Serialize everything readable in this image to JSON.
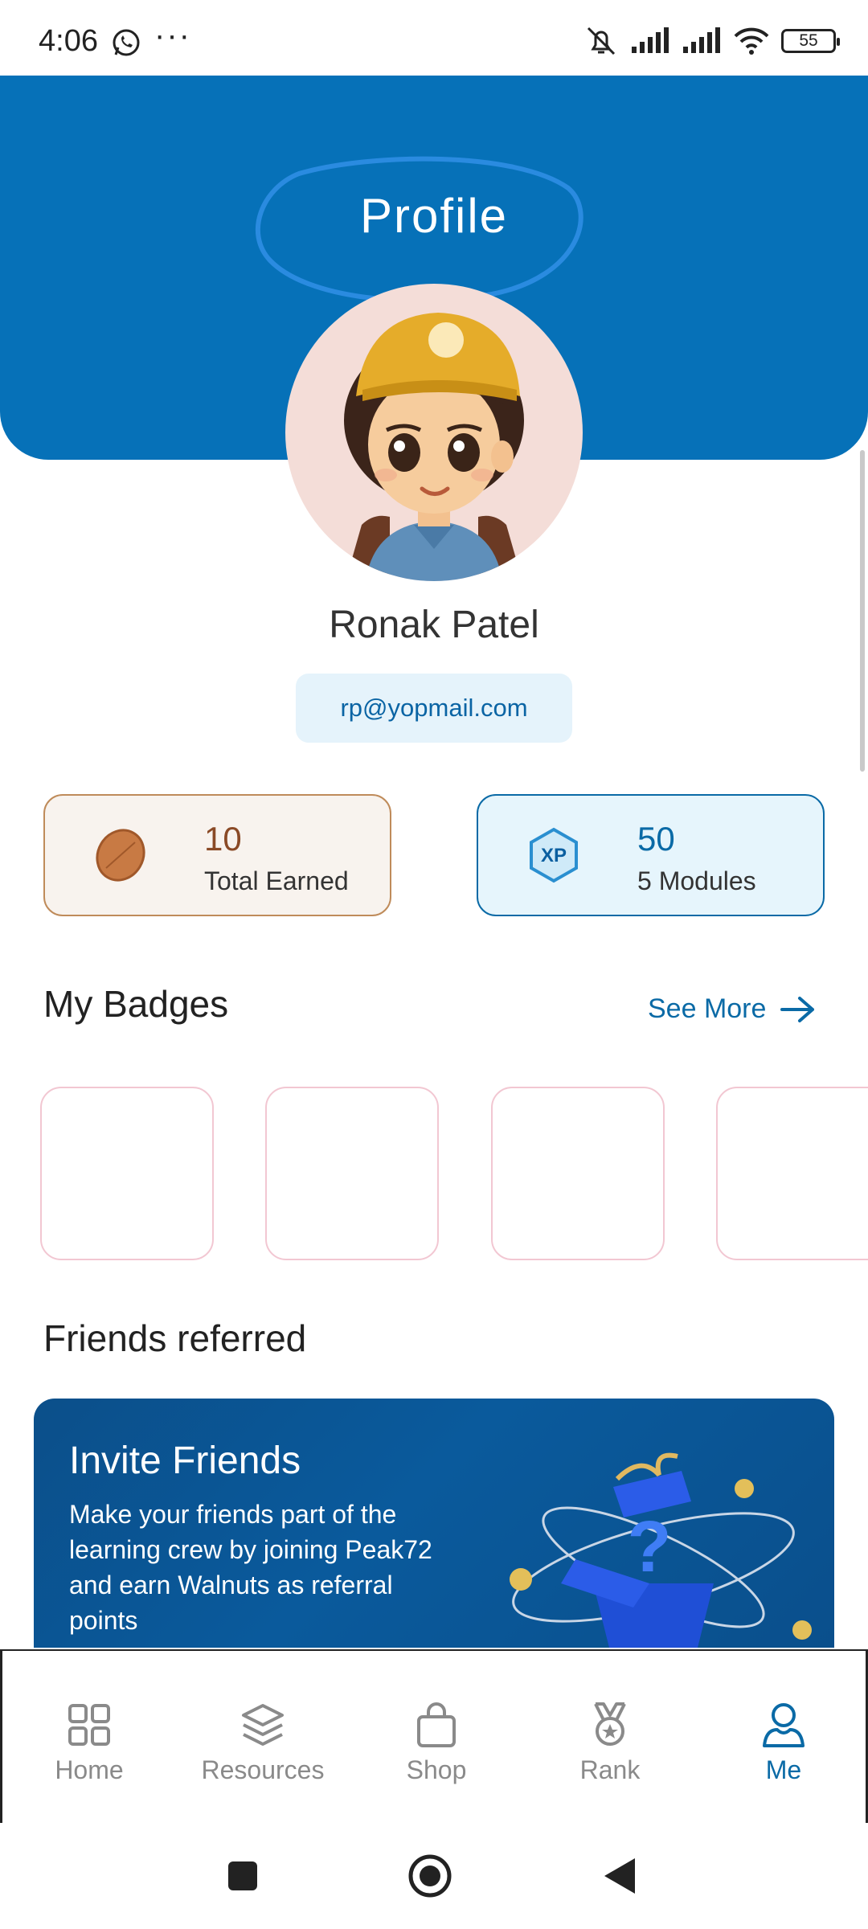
{
  "status_bar": {
    "time": "4:06",
    "dots": "···",
    "battery": "55"
  },
  "header": {
    "title": "Profile",
    "accent": "#0671b8"
  },
  "profile": {
    "name": "Ronak Patel",
    "email": "rp@yopmail.com"
  },
  "stats": [
    {
      "icon": "walnut-icon",
      "value": "10",
      "label": "Total Earned"
    },
    {
      "icon": "xp-icon",
      "value": "50",
      "label": "5 Modules"
    }
  ],
  "badges": {
    "title": "My Badges",
    "see_more": "See More"
  },
  "friends": {
    "title": "Friends referred",
    "invite_title": "Invite Friends",
    "invite_text": "Make your friends part of the learning crew by joining Peak72 and earn Walnuts as referral points"
  },
  "nav": [
    {
      "label": "Home",
      "icon": "home-icon"
    },
    {
      "label": "Resources",
      "icon": "layers-icon"
    },
    {
      "label": "Shop",
      "icon": "shopping-bag-icon"
    },
    {
      "label": "Rank",
      "icon": "medal-icon"
    },
    {
      "label": "Me",
      "icon": "user-icon",
      "active": true
    }
  ]
}
